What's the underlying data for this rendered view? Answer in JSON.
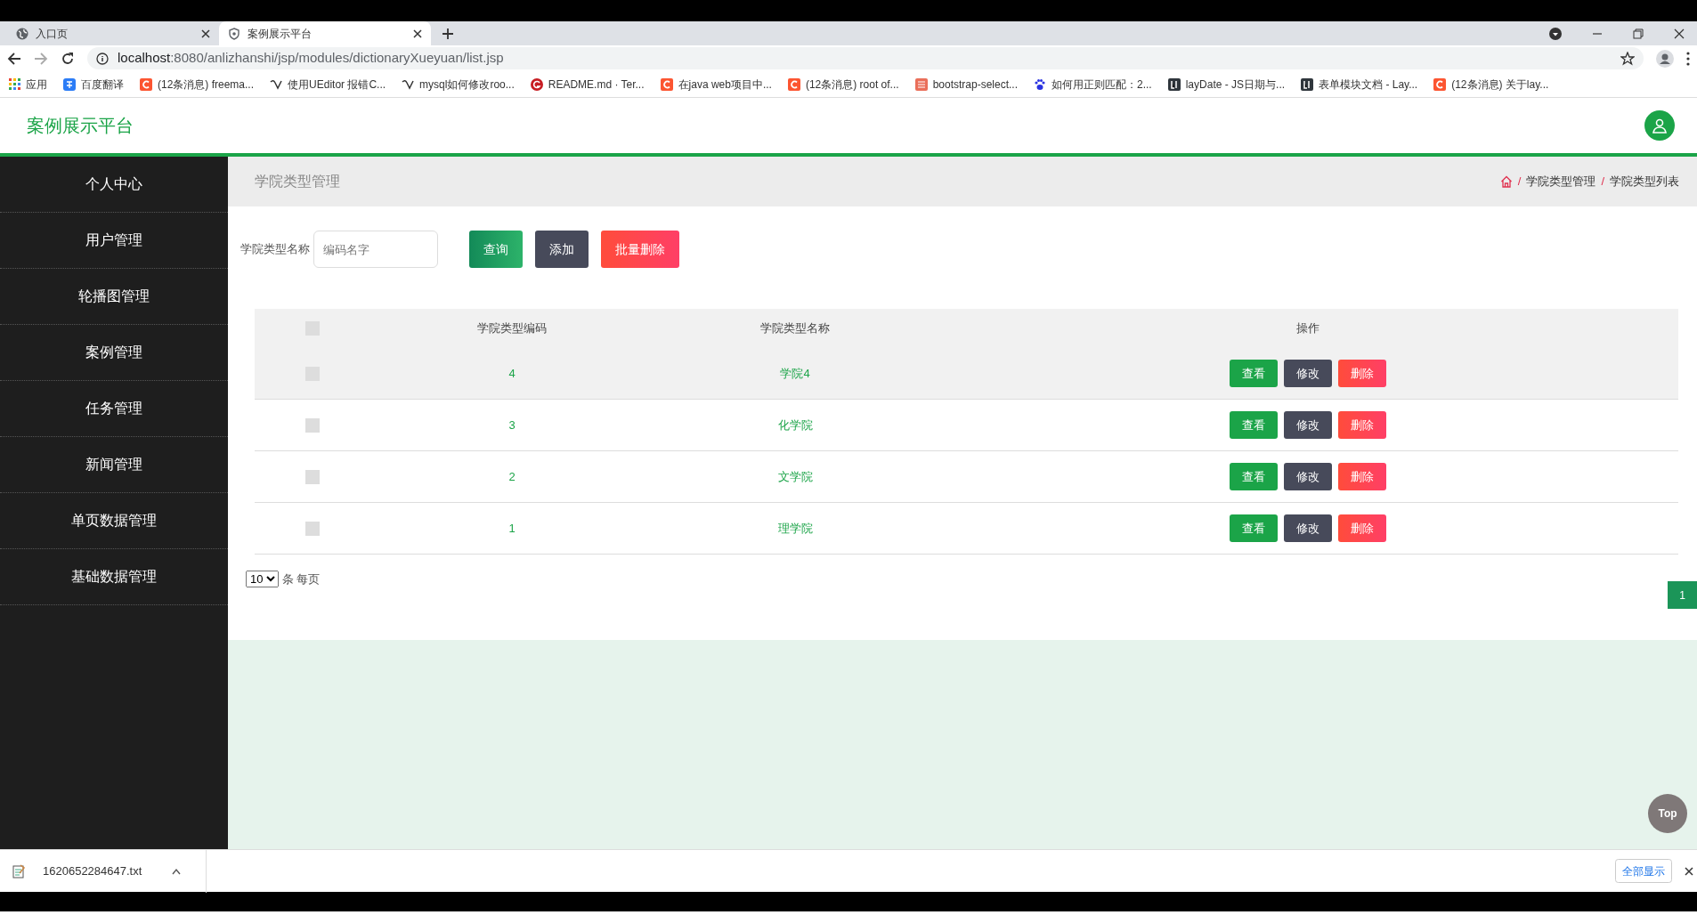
{
  "browser": {
    "tabs": [
      {
        "title": "入口页",
        "kind": "globe",
        "selected": false
      },
      {
        "title": "案例展示平台",
        "kind": "shield",
        "selected": true
      }
    ],
    "address": {
      "host": "localhost",
      "rest": ":8080/anlizhanshi/jsp/modules/dictionaryXueyuan/list.jsp"
    },
    "bookmarks": [
      {
        "label": "应用",
        "kind": "apps"
      },
      {
        "label": "百度翻译",
        "kind": "translate"
      },
      {
        "label": "(12条消息) freema...",
        "kind": "csdn"
      },
      {
        "label": "使用UEditor 报错C...",
        "kind": "ueditor"
      },
      {
        "label": "mysql如何修改roo...",
        "kind": "ueditor"
      },
      {
        "label": "README.md · Ter...",
        "kind": "gitee"
      },
      {
        "label": "在java web项目中...",
        "kind": "csdn"
      },
      {
        "label": "(12条消息) root of...",
        "kind": "csdn"
      },
      {
        "label": "bootstrap-select...",
        "kind": "jianshu"
      },
      {
        "label": "如何用正则匹配：2...",
        "kind": "baidu"
      },
      {
        "label": "layDate - JS日期与...",
        "kind": "layui"
      },
      {
        "label": "表单模块文档 - Lay...",
        "kind": "layui"
      },
      {
        "label": "(12条消息) 关于lay...",
        "kind": "csdn"
      }
    ]
  },
  "header": {
    "title": "案例展示平台"
  },
  "sidebar": {
    "items": [
      {
        "label": "个人中心"
      },
      {
        "label": "用户管理"
      },
      {
        "label": "轮播图管理"
      },
      {
        "label": "案例管理"
      },
      {
        "label": "任务管理"
      },
      {
        "label": "新闻管理"
      },
      {
        "label": "单页数据管理"
      },
      {
        "label": "基础数据管理"
      }
    ]
  },
  "page_title": "学院类型管理",
  "breadcrumb": [
    {
      "separator": "/",
      "label": "学院类型管理"
    },
    {
      "separator": "/",
      "label": "学院类型列表"
    }
  ],
  "search": {
    "label": "学院类型名称",
    "placeholder": "编码名字"
  },
  "toolbar": [
    {
      "label": "查询",
      "kind": "search"
    },
    {
      "label": "添加",
      "kind": "add"
    },
    {
      "label": "批量删除",
      "kind": "delete"
    }
  ],
  "table": {
    "select_all_checked": false,
    "columns": [
      "学院类型编码",
      "学院类型名称",
      "操作"
    ],
    "rows": [
      {
        "code": "4",
        "name": "学院4",
        "checked": false,
        "highlighted": true,
        "actions": [
          {
            "label": "查看",
            "kind": "view"
          },
          {
            "label": "修改",
            "kind": "edit"
          },
          {
            "label": "删除",
            "kind": "delete"
          }
        ]
      },
      {
        "code": "3",
        "name": "化学院",
        "checked": false,
        "highlighted": false,
        "actions": [
          {
            "label": "查看",
            "kind": "view"
          },
          {
            "label": "修改",
            "kind": "edit"
          },
          {
            "label": "删除",
            "kind": "delete"
          }
        ]
      },
      {
        "code": "2",
        "name": "文学院",
        "checked": false,
        "highlighted": false,
        "actions": [
          {
            "label": "查看",
            "kind": "view"
          },
          {
            "label": "修改",
            "kind": "edit"
          },
          {
            "label": "删除",
            "kind": "delete"
          }
        ]
      },
      {
        "code": "1",
        "name": "理学院",
        "checked": false,
        "highlighted": false,
        "actions": [
          {
            "label": "查看",
            "kind": "view"
          },
          {
            "label": "修改",
            "kind": "edit"
          },
          {
            "label": "删除",
            "kind": "delete"
          }
        ]
      }
    ]
  },
  "pagination": {
    "page_size": "10",
    "page_size_suffix": "条 每页",
    "pages": [
      {
        "label": "1",
        "selected": true
      }
    ]
  },
  "back_to_top": "Top",
  "download_bar": {
    "file": "1620652284647.txt",
    "show_all": "全部显示"
  }
}
